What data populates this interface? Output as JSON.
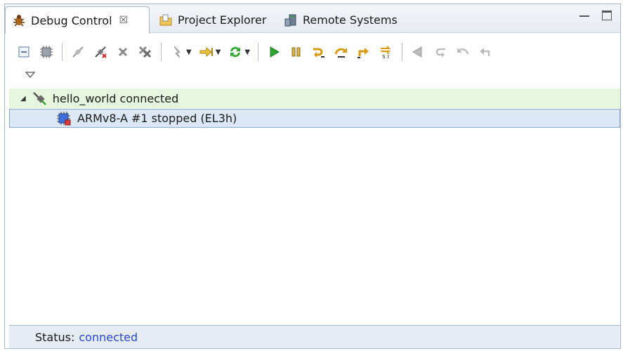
{
  "tabs": [
    {
      "label": "Debug Control",
      "icon": "debug-bug-icon",
      "active": true
    },
    {
      "label": "Project Explorer",
      "icon": "project-folder-icon",
      "active": false
    },
    {
      "label": "Remote Systems",
      "icon": "remote-systems-icon",
      "active": false
    }
  ],
  "tab_close_symbol": "☒",
  "tree": {
    "connection": {
      "label": "hello_world connected",
      "icon": "connection-plug-icon"
    },
    "core": {
      "label": "ARMv8-A #1 stopped (EL3h)",
      "icon": "processor-chip-icon"
    }
  },
  "status": {
    "label": "Status:",
    "value": "connected"
  },
  "colors": {
    "accent_green": "#2ea52e",
    "link_blue": "#2a47d8",
    "selection": "#dde8f6",
    "connected_row": "#e6f5dd"
  }
}
